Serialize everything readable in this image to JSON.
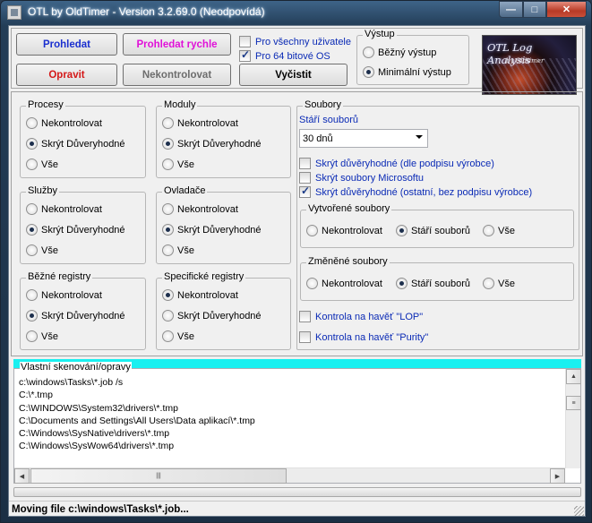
{
  "window": {
    "title": "OTL by OldTimer - Version 3.2.69.0 (Neodpovídá)",
    "min": "—",
    "max": "□",
    "close": "✕"
  },
  "toolbar": {
    "scan": "Prohledat",
    "scan_quick": "Prohledat rychle",
    "fix": "Opravit",
    "unchecked": "Nekontrolovat",
    "clear": "Vyčistit",
    "all_users": "Pro všechny uživatele",
    "os64": "Pro 64 bitové OS"
  },
  "output": {
    "title": "Výstup",
    "standard": "Běžný výstup",
    "minimal": "Minimální výstup"
  },
  "logo": {
    "line1": "OTL Log Analysis",
    "line2": "by Oldtimer"
  },
  "groups": {
    "procesy": {
      "title": "Procesy"
    },
    "moduly": {
      "title": "Moduly"
    },
    "sluzby": {
      "title": "Služby"
    },
    "ovladace": {
      "title": "Ovladače"
    },
    "bezne": {
      "title": "Běžné registry"
    },
    "specificke": {
      "title": "Specifické registry"
    }
  },
  "opts": {
    "none": "Nekontrolovat",
    "hide": "Skrýt Důveryhodné",
    "all": "Vše"
  },
  "soubory": {
    "title": "Soubory",
    "age_label": "Stáří souborů",
    "age_value": "30 dnů",
    "hide_signed": "Skrýt důvěryhodné (dle podpisu výrobce)",
    "hide_ms": "Skrýt soubory Microsoftu",
    "hide_other": "Skrýt důvěryhodné (ostatní, bez podpisu výrobce)",
    "created": {
      "title": "Vytvořené soubory",
      "none": "Nekontrolovat",
      "age": "Stáří souborů",
      "all": "Vše"
    },
    "changed": {
      "title": "Změněné soubory",
      "none": "Nekontrolovat",
      "age": "Stáří souborů",
      "all": "Vše"
    },
    "lop": "Kontrola na havěť \"LOP\"",
    "purity": "Kontrola na havěť \"Purity\""
  },
  "custom": {
    "title": "Vlastní skenování/opravy",
    "lines": [
      "c:\\windows\\Tasks\\*.job /s",
      "C:\\*.tmp",
      "C:\\WINDOWS\\System32\\drivers\\*.tmp",
      "C:\\Documents and Settings\\All Users\\Data aplikací\\*.tmp",
      "C:\\Windows\\SysNative\\drivers\\*.tmp",
      "C:\\Windows\\SysWow64\\drivers\\*.tmp"
    ]
  },
  "status": "Moving file c:\\windows\\Tasks\\*.job...",
  "colors": {
    "scan": "#1a2fcf",
    "scan_quick": "#e011d8",
    "fix": "#d41818",
    "unchecked": "#6d6d6d",
    "link": "#0a2ab5",
    "bar": "#19f0f0"
  }
}
